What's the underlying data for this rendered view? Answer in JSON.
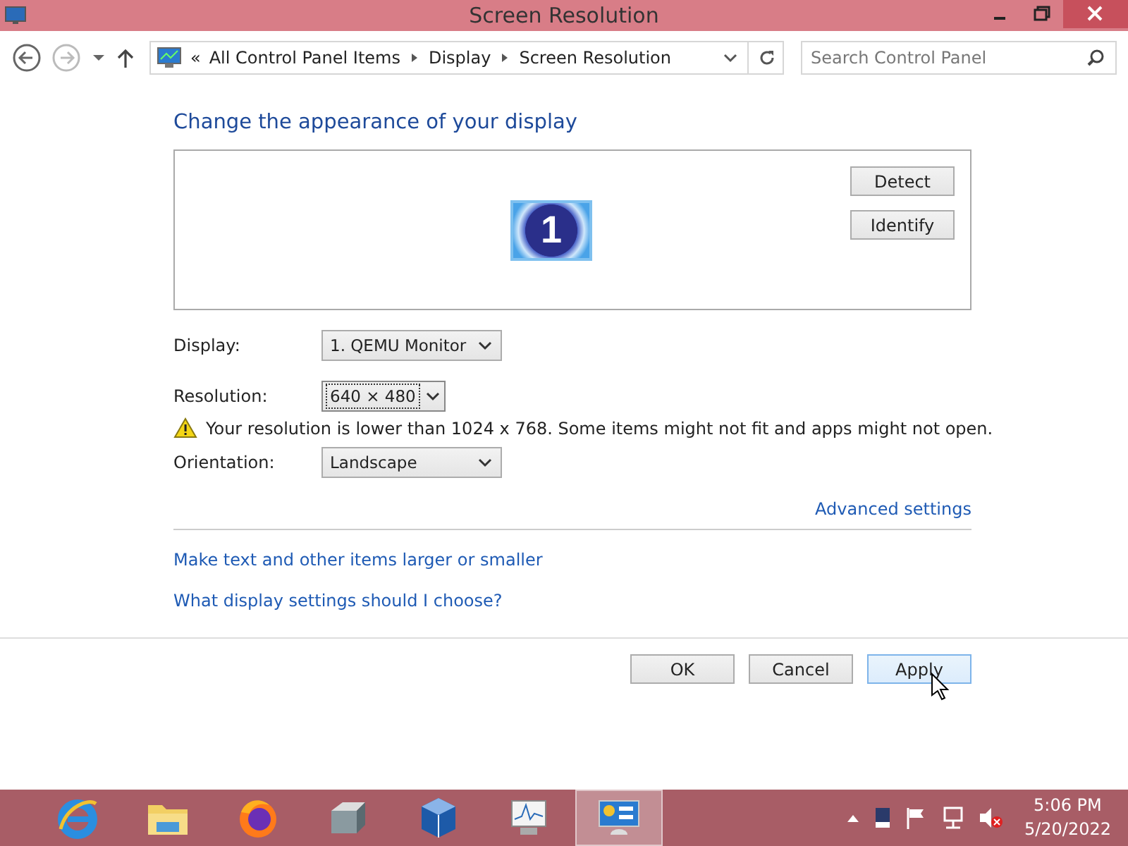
{
  "window": {
    "title": "Screen Resolution"
  },
  "address_bar": {
    "breadcrumbs": [
      "«",
      "All Control Panel Items",
      "Display",
      "Screen Resolution"
    ]
  },
  "search": {
    "placeholder": "Search Control Panel"
  },
  "heading": "Change the appearance of your display",
  "monitor_preview": {
    "label": "1",
    "buttons": [
      "Detect",
      "Identify"
    ]
  },
  "settings": [
    {
      "label": "Display:",
      "value": "1. QEMU Monitor",
      "focused": false
    },
    {
      "label": "Resolution:",
      "value": "640 × 480",
      "focused": true
    },
    {
      "label": "Orientation:",
      "value": "Landscape",
      "focused": false
    }
  ],
  "warning": "Your resolution is lower than 1024 x 768. Some items might not fit and apps might not open.",
  "advanced_link": "Advanced settings",
  "links": [
    "Make text and other items larger or smaller",
    "What display settings should I choose?"
  ],
  "buttons": [
    {
      "label": "OK",
      "hovered": false
    },
    {
      "label": "Cancel",
      "hovered": false
    },
    {
      "label": "Apply",
      "hovered": true
    }
  ],
  "taskbar": {
    "apps": [
      {
        "kind": "ie",
        "selected": false
      },
      {
        "kind": "explorer",
        "selected": false
      },
      {
        "kind": "firefox",
        "selected": false
      },
      {
        "kind": "drive",
        "selected": false
      },
      {
        "kind": "virtualbox",
        "selected": false
      },
      {
        "kind": "monitor",
        "selected": false
      },
      {
        "kind": "controlpanel",
        "selected": true
      }
    ],
    "clock": {
      "time": "5:06 PM",
      "date": "5/20/2022"
    }
  }
}
